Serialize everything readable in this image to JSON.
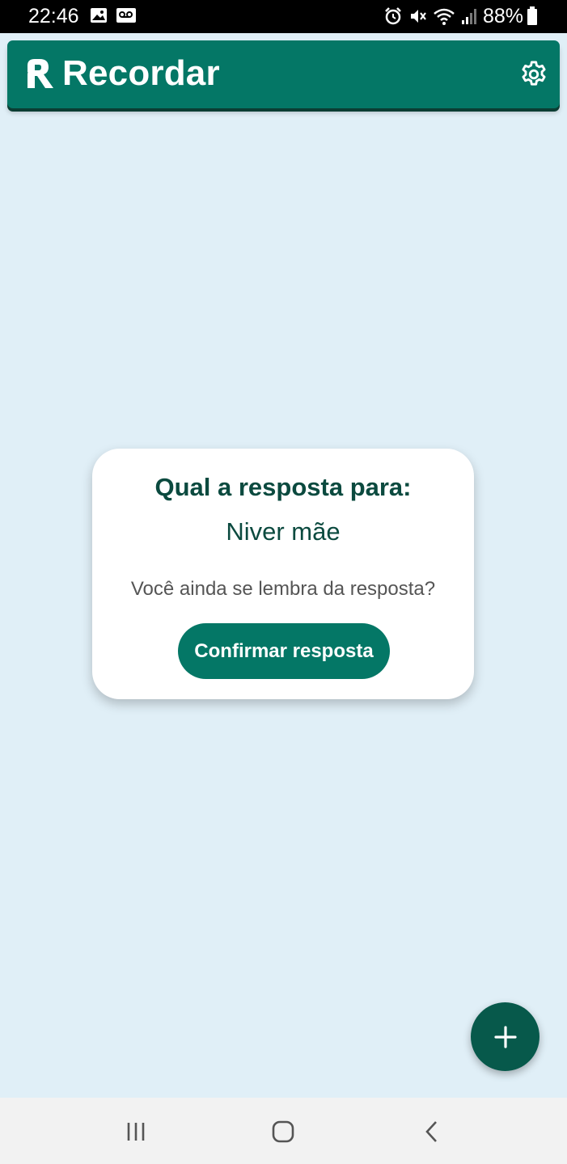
{
  "status_bar": {
    "time": "22:46",
    "battery": "88%",
    "icons": [
      "image-icon",
      "voicemail-icon",
      "alarm-icon",
      "mute-icon",
      "wifi-icon",
      "signal-icon",
      "battery-icon"
    ]
  },
  "header": {
    "title": "Recordar",
    "logo_icon": "recordar-logo-icon",
    "settings_icon": "gear-icon"
  },
  "card": {
    "title": "Qual a resposta para:",
    "question": "Niver mãe",
    "prompt": "Você ainda se lembra da resposta?",
    "confirm_label": "Confirmar resposta"
  },
  "fab": {
    "icon": "plus-icon"
  },
  "nav": {
    "icons": [
      "recent-apps-icon",
      "home-icon",
      "back-icon"
    ]
  },
  "colors": {
    "primary": "#047766",
    "primary_dark": "#07594b",
    "background": "#e0eff7",
    "title_text": "#0b4a3f"
  }
}
